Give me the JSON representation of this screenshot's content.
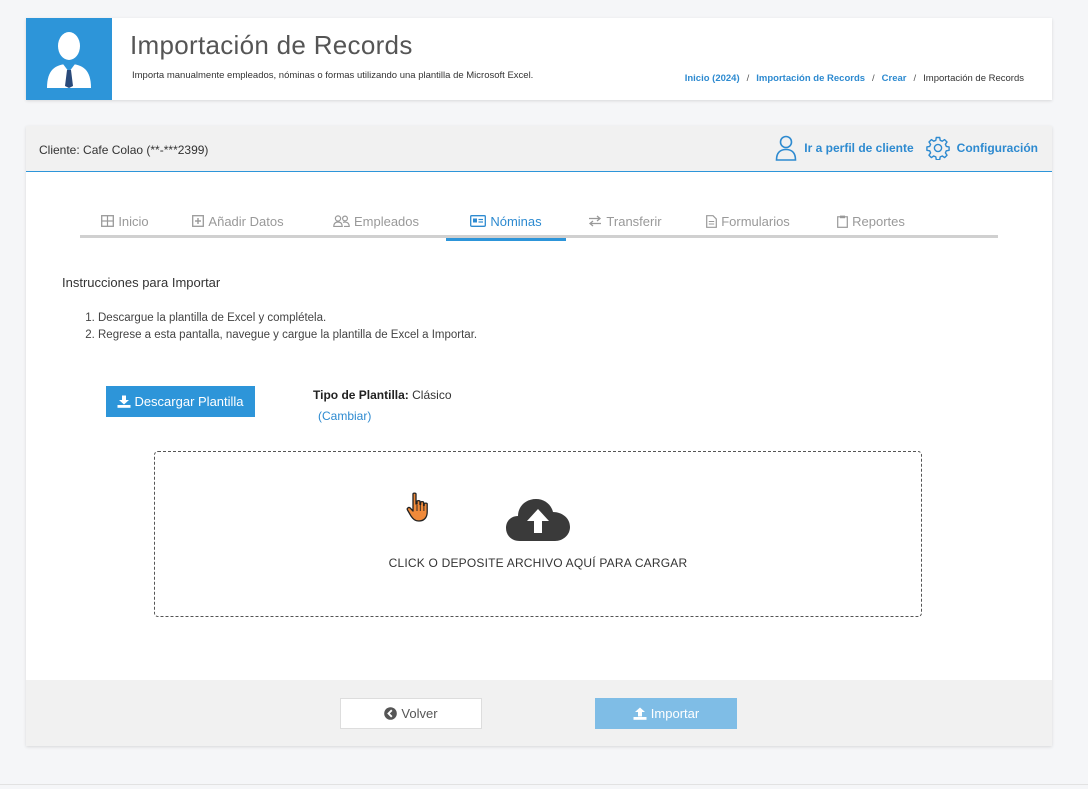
{
  "header": {
    "title": "Importación de Records",
    "subtitle": "Importa manualmente empleados, nóminas o formas utilizando una plantilla de Microsoft Excel.",
    "icon": "employee-avatar-icon",
    "icon_bg_color": "#2d95d9"
  },
  "breadcrumb": {
    "items": [
      "Inicio (2024)",
      "Importación de Records",
      "Crear"
    ],
    "current": "Importación de Records",
    "separator": "/"
  },
  "client_bar": {
    "client_label": "Cliente: Cafe Colao (**-***2399)",
    "profile_link": "Ir a perfil de cliente",
    "config_link": "Configuración"
  },
  "tabs": [
    {
      "label": "Inicio",
      "icon": "grid-icon",
      "active": false
    },
    {
      "label": "Añadir Datos",
      "icon": "plus-square-icon",
      "active": false
    },
    {
      "label": "Empleados",
      "icon": "users-icon",
      "active": false
    },
    {
      "label": "Nóminas",
      "icon": "id-card-icon",
      "active": true
    },
    {
      "label": "Transferir",
      "icon": "transfer-icon",
      "active": false
    },
    {
      "label": "Formularios",
      "icon": "document-icon",
      "active": false
    },
    {
      "label": "Reportes",
      "icon": "clipboard-icon",
      "active": false
    }
  ],
  "instructions": {
    "title": "Instrucciones para Importar",
    "steps": [
      "Descargue la plantilla de Excel y complétela.",
      "Regrese a esta pantalla, navegue y cargue la plantilla de Excel a Importar."
    ]
  },
  "template": {
    "download_label": "Descargar Plantilla",
    "type_label": "Tipo de Plantilla:",
    "type_value": "Clásico",
    "change_label": "(Cambiar)"
  },
  "dropzone": {
    "text": "CLICK O DEPOSITE ARCHIVO AQUÍ PARA CARGAR",
    "icon": "cloud-upload-icon"
  },
  "footer": {
    "back_label": "Volver",
    "import_label": "Importar"
  },
  "colors": {
    "accent": "#2d95d9",
    "link": "#2d8ad0",
    "import_disabled": "#7fbde6"
  }
}
